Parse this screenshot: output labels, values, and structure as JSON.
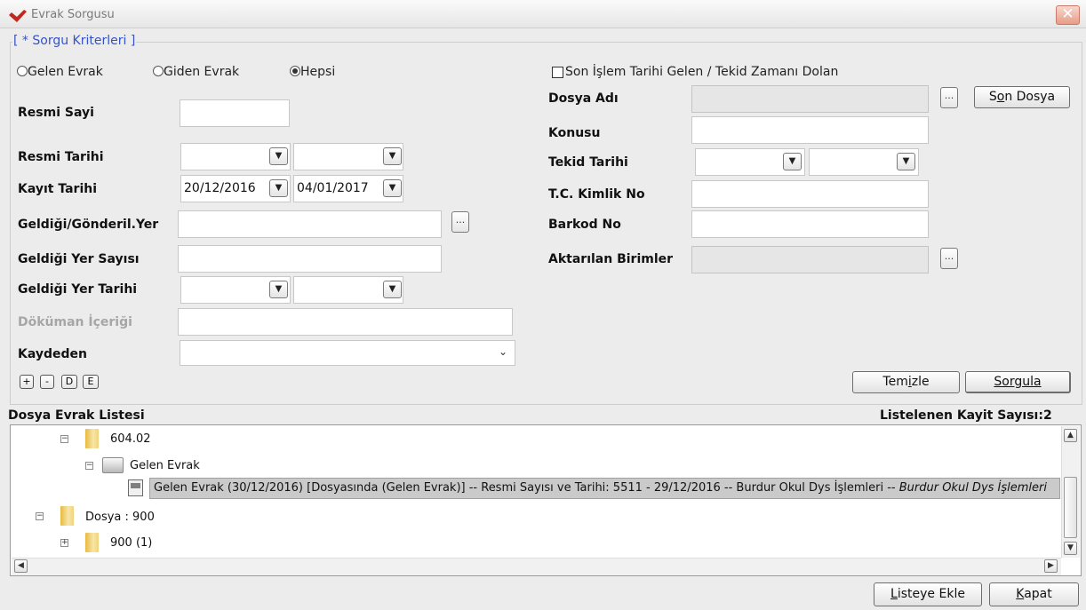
{
  "window": {
    "title": "Evrak Sorgusu",
    "close_glyph": "✕"
  },
  "group": {
    "legend": "[ * Sorgu Kriterleri ]"
  },
  "radios": [
    {
      "label": "Gelen Evrak",
      "selected": false
    },
    {
      "label": "Giden Evrak",
      "selected": false
    },
    {
      "label": "Hepsi",
      "selected": true
    }
  ],
  "left": {
    "resmi_sayi": {
      "label": "Resmi Sayi",
      "value": ""
    },
    "resmi_tarihi": {
      "label": "Resmi Tarihi",
      "from": "",
      "to": ""
    },
    "kayit_tarihi": {
      "label": "Kayıt Tarihi",
      "from": "20/12/2016",
      "to": "04/01/2017"
    },
    "geldigi_yer": {
      "label": "Geldiği/Gönderil.Yer",
      "value": ""
    },
    "geldigi_yer_sayisi": {
      "label": "Geldiği Yer Sayısı",
      "value": ""
    },
    "geldigi_yer_tarihi": {
      "label": "Geldiği Yer Tarihi",
      "from": "",
      "to": ""
    },
    "dokuman_icerigi": {
      "label": "Döküman İçeriği",
      "value": ""
    },
    "kaydeden": {
      "label": "Kaydeden",
      "value": ""
    },
    "small_buttons": [
      "+",
      "-",
      "D",
      "E"
    ]
  },
  "right": {
    "checkbox_label": "Son İşlem Tarihi Gelen / Tekid Zamanı Dolan",
    "dosya_adi": {
      "label": "Dosya Adı",
      "value": ""
    },
    "son_dosya_pre": "S",
    "son_dosya_ul": "o",
    "son_dosya_post": "n Dosya",
    "konusu": {
      "label": "Konusu",
      "value": ""
    },
    "tekid_tarihi": {
      "label": "Tekid Tarihi",
      "from": "",
      "to": ""
    },
    "tc_kimlik": {
      "label": "T.C. Kimlik No",
      "value": ""
    },
    "barkod": {
      "label": "Barkod No",
      "value": ""
    },
    "aktarilan": {
      "label": "Aktarılan Birimler",
      "value": ""
    },
    "dots": "...",
    "temizle_pre": "Tem",
    "temizle_ul": "i",
    "temizle_post": "zle",
    "sorgula_pre": "Sorgul",
    "sorgula_ul": "a"
  },
  "list": {
    "title": "Dosya Evrak Listesi",
    "count_label": "Listelenen Kayit Sayısı:2",
    "tree": [
      {
        "label": "604.02"
      },
      {
        "label": "Gelen Evrak"
      },
      {
        "label": "Gelen Evrak (30/12/2016) [Dosyasında (Gelen Evrak)] -- Resmi Sayısı ve Tarihi: 5511 - 29/12/2016 -- Burdur Okul Dys İşlemleri -- ",
        "label_italic": "Burdur Okul Dys İşlemleri"
      },
      {
        "label": "Dosya : 900"
      },
      {
        "label": "900 (1)"
      }
    ]
  },
  "footer": {
    "listeye_ekle_ul": "L",
    "listeye_ekle_post": "isteye Ekle",
    "kapat_ul": "K",
    "kapat_post": "apat"
  }
}
